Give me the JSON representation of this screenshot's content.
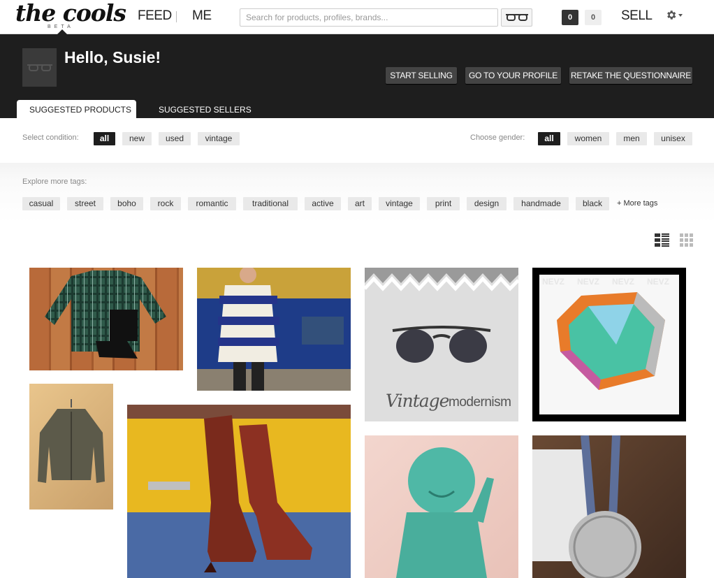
{
  "brand": {
    "logo": "the cools",
    "beta": "BETA"
  },
  "nav": {
    "feed": "FEED",
    "me": "ME",
    "sell": "SELL"
  },
  "search": {
    "placeholder": "Search for products, profiles, brands..."
  },
  "counts": {
    "left": "0",
    "right": "0"
  },
  "hero": {
    "greeting": "Hello, Susie!",
    "buttons": [
      "START SELLING",
      "GO TO YOUR PROFILE",
      "RETAKE THE QUESTIONNAIRE"
    ],
    "tabs": [
      "SUGGESTED PRODUCTS",
      "SUGGESTED SELLERS"
    ]
  },
  "filters": {
    "condition_label": "Select condition:",
    "conditions": [
      "all",
      "new",
      "used",
      "vintage"
    ],
    "gender_label": "Choose gender:",
    "genders": [
      "all",
      "women",
      "men",
      "unisex"
    ]
  },
  "tags": {
    "label": "Explore more tags:",
    "items": [
      "casual",
      "street",
      "boho",
      "rock",
      "romantic",
      "traditional",
      "active",
      "art",
      "vintage",
      "print",
      "design",
      "handmade",
      "black"
    ],
    "more": "+ More tags"
  },
  "products": [
    {
      "subject": "plaid flannel shirt"
    },
    {
      "subject": "patterned knit sweater"
    },
    {
      "subject": "vintage sunglasses",
      "caption_script": "Vintage",
      "caption": "modernism"
    },
    {
      "subject": "geometric bangle",
      "watermark": "NEVZ"
    },
    {
      "subject": "fringe suede jacket"
    },
    {
      "subject": "red leather boots"
    },
    {
      "subject": "turquoise buddha figurine"
    },
    {
      "subject": "coin pendant necklace"
    }
  ],
  "colors": {
    "dark": "#1e1e1e",
    "chip": "#e9e9e9",
    "accent": "#ffffff"
  }
}
